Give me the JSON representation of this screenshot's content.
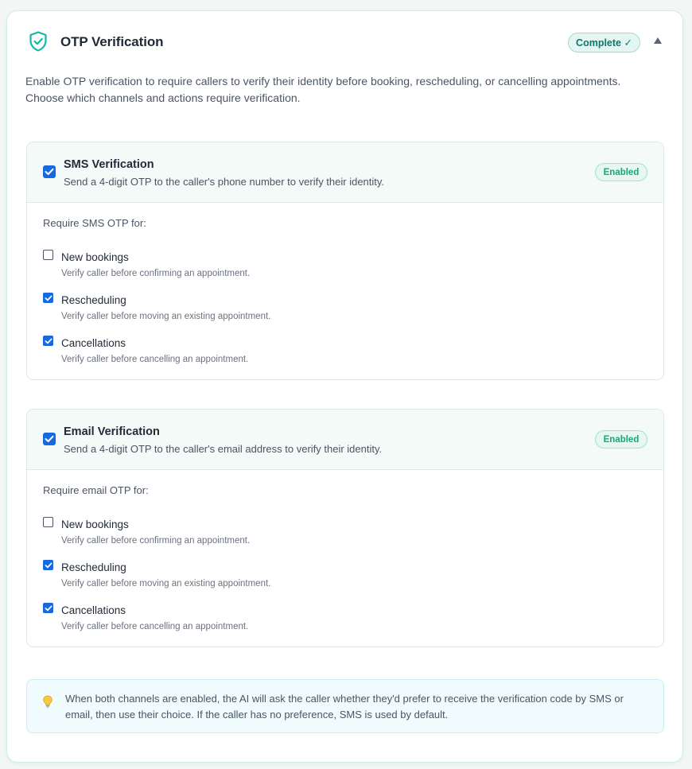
{
  "header": {
    "title": "OTP Verification",
    "status_badge": "Complete ✓",
    "shield_icon": "shield-check-icon",
    "collapse_icon": "chevron-up-icon"
  },
  "description": "Enable OTP verification to require callers to verify their identity before booking, rescheduling, or cancelling appointments. Choose which channels and actions require verification.",
  "channels": [
    {
      "title": "SMS Verification",
      "subtitle": "Send a 4-digit OTP to the caller's phone number to verify their identity.",
      "badge": "Enabled",
      "checked": true,
      "require_label": "Require SMS OTP for:",
      "options": [
        {
          "title": "New bookings",
          "subtitle": "Verify caller before confirming an appointment.",
          "checked": false
        },
        {
          "title": "Rescheduling",
          "subtitle": "Verify caller before moving an existing appointment.",
          "checked": true
        },
        {
          "title": "Cancellations",
          "subtitle": "Verify caller before cancelling an appointment.",
          "checked": true
        }
      ]
    },
    {
      "title": "Email Verification",
      "subtitle": "Send a 4-digit OTP to the caller's email address to verify their identity.",
      "badge": "Enabled",
      "checked": true,
      "require_label": "Require email OTP for:",
      "options": [
        {
          "title": "New bookings",
          "subtitle": "Verify caller before confirming an appointment.",
          "checked": false
        },
        {
          "title": "Rescheduling",
          "subtitle": "Verify caller before moving an existing appointment.",
          "checked": true
        },
        {
          "title": "Cancellations",
          "subtitle": "Verify caller before cancelling an appointment.",
          "checked": true
        }
      ]
    }
  ],
  "note": {
    "icon": "lightbulb-icon",
    "text": "When both channels are enabled, the AI will ask the caller whether they'd prefer to receive the verification code by SMS or email, then use their choice. If the caller has no preference, SMS is used by default."
  },
  "colors": {
    "accent": "#14b8a6",
    "checkbox": "#1769e0",
    "badge_text": "#0f766e"
  }
}
